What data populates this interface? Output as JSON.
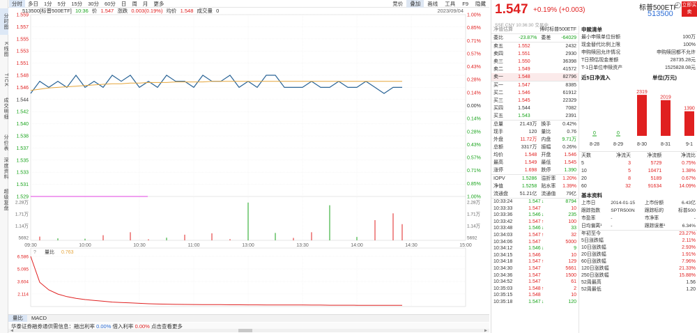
{
  "left_nav": [
    {
      "label": "分时图",
      "active": true
    },
    {
      "label": "K线图",
      "active": false
    },
    {
      "label": "TICK",
      "active": false
    },
    {
      "label": "成交明细",
      "active": false
    },
    {
      "label": "分价表",
      "active": false
    },
    {
      "label": "深度资料",
      "active": false
    },
    {
      "label": "超级复盘",
      "active": false
    }
  ],
  "toolbar": {
    "tabs": [
      "分时",
      "多日",
      "1分",
      "5分",
      "15分",
      "30分",
      "60分",
      "日",
      "周",
      "月",
      "更多"
    ],
    "right": [
      "竞价",
      "叠加",
      "画线",
      "工具",
      "F9",
      "隐藏"
    ]
  },
  "info": {
    "name": "513500[标普500ETF]",
    "time": "10:36",
    "price_label": "价",
    "price": "1.547",
    "chg_label": "涨跌",
    "chg": "0.003(0.19%)",
    "avg_label": "均价",
    "avg": "1.548",
    "vol_label": "成交量",
    "vol": "0",
    "date": "2023/09/04"
  },
  "chart_data": {
    "type": "line",
    "x_ticks": [
      "09:30",
      "10:00",
      "10:30",
      "11:00",
      "13:00",
      "13:30",
      "14:00",
      "14:30",
      "15:00"
    ],
    "price_ticks_left": [
      "1.559",
      "1.557",
      "1.555",
      "1.553",
      "1.551",
      "1.548",
      "1.546",
      "1.544",
      "1.542",
      "1.540",
      "1.538",
      "1.537",
      "1.535",
      "1.533",
      "1.531",
      "1.529"
    ],
    "price_ticks_right": [
      "1.00%",
      "0.85%",
      "0.71%",
      "0.57%",
      "0.43%",
      "0.28%",
      "0.14%",
      "0.00%",
      "0.14%",
      "0.28%",
      "0.43%",
      "0.57%",
      "0.71%",
      "0.85%",
      "1.00%"
    ],
    "ylim": [
      1.529,
      1.559
    ],
    "series": [
      {
        "values": [
          1.546,
          1.548,
          1.547,
          1.548,
          1.547,
          1.549,
          1.547,
          1.548,
          1.547,
          1.549,
          1.548,
          1.549,
          1.547,
          1.548,
          1.547,
          1.549,
          1.548,
          1.548,
          1.547,
          1.549,
          1.548,
          1.548,
          1.549,
          1.547,
          1.548,
          1.547,
          1.549,
          1.549,
          1.547,
          1.547,
          1.547,
          1.548,
          1.547,
          1.547,
          1.548,
          1.547,
          1.547,
          1.548,
          1.547,
          1.546,
          1.547,
          1.547
        ]
      },
      {
        "values": [
          1.5465,
          1.5467,
          1.5469,
          1.547,
          1.5471,
          1.5472,
          1.5473,
          1.5474,
          1.5475,
          1.5476,
          1.5476,
          1.5477,
          1.5477,
          1.5478,
          1.5478,
          1.5478,
          1.5479,
          1.5479,
          1.5479,
          1.5479,
          1.548,
          1.548,
          1.548,
          1.548,
          1.548,
          1.548,
          1.548,
          1.548,
          1.548,
          1.548,
          1.548,
          1.548,
          1.548,
          1.548,
          1.548,
          1.548,
          1.548,
          1.548,
          1.548,
          1.548,
          1.548,
          1.548
        ]
      }
    ],
    "volume_ticks": [
      "2.28万",
      "1.71万",
      "1.14万",
      "5692"
    ],
    "volume_max": 28400,
    "volumes": [
      0,
      2800,
      0,
      1500,
      0,
      0,
      1200,
      0,
      3800,
      0,
      0,
      6000,
      0,
      800,
      0,
      2000,
      0,
      4200,
      0,
      0,
      5200,
      0,
      900,
      0,
      28000,
      0,
      0,
      5500,
      0,
      1800,
      0,
      6000,
      0,
      26000,
      0,
      0,
      2500,
      0,
      15000,
      0,
      20000,
      12000
    ],
    "volratio": {
      "label": "量比",
      "value": "0.763",
      "ticks": [
        "6.586",
        "5.095",
        "3.604",
        "2.114"
      ],
      "ylim": [
        0.62,
        6.586
      ],
      "values": [
        6.586,
        3.5,
        2.6,
        2.1,
        1.8,
        1.6,
        1.45,
        1.35,
        1.25,
        1.15,
        1.1,
        1.05,
        1.0,
        0.95,
        0.92,
        0.9,
        0.88,
        0.87,
        0.86,
        0.85,
        0.84,
        0.84,
        0.83,
        0.83,
        0.82,
        0.82,
        0.81,
        0.81,
        0.8,
        0.8,
        0.8,
        0.79,
        0.79,
        0.78,
        0.78,
        0.78,
        0.77,
        0.77,
        0.77,
        0.77,
        0.76,
        0.763
      ]
    },
    "colors": {
      "price": "#2a6496",
      "avg": "#e5a53a",
      "ref": "#e040e0",
      "vol": "#e02020",
      "volratio": "#e02020"
    }
  },
  "bottom_tabs": [
    "量比",
    "MACD"
  ],
  "status": {
    "text1": "华泰证券融券通供需信息：融出利率",
    "v1": "0.00%",
    "text2": "借入利率",
    "v2": "0.00%",
    "text3": "点击查看更多"
  },
  "quote": {
    "price": "1.547",
    "change": "+0.19% (+0.003)",
    "name": "标普500ETF",
    "code": "513500",
    "buy_btn": "立即买卖",
    "info_icon": "i",
    "subline": "SSE  CNY  10:36:30  交易中",
    "book_head": {
      "left": "净值估算",
      "right": "博时标普500ETF"
    },
    "weibi": {
      "label": "委比",
      "value": "-23.87%",
      "label2": "委差",
      "value2": "-64029"
    },
    "asks": [
      {
        "label": "卖五",
        "price": "1.552",
        "vol": "2432"
      },
      {
        "label": "卖四",
        "price": "1.551",
        "vol": "2930"
      },
      {
        "label": "卖三",
        "price": "1.550",
        "vol": "36398"
      },
      {
        "label": "卖二",
        "price": "1.549",
        "vol": "41572"
      },
      {
        "label": "卖一",
        "price": "1.548",
        "vol": "82796"
      }
    ],
    "bids": [
      {
        "label": "买一",
        "price": "1.547",
        "vol": "8385"
      },
      {
        "label": "买二",
        "price": "1.546",
        "vol": "61912"
      },
      {
        "label": "买三",
        "price": "1.545",
        "vol": "22329"
      },
      {
        "label": "买四",
        "price": "1.544",
        "vol": "7082"
      },
      {
        "label": "买五",
        "price": "1.543",
        "vol": "2391"
      }
    ],
    "stats": [
      {
        "l1": "总量",
        "v1": "21.43万",
        "l2": "换手",
        "v2": "0.42%",
        "c1": "",
        "c2": ""
      },
      {
        "l1": "现手",
        "v1": "120",
        "l2": "量比",
        "v2": "0.76",
        "c1": "",
        "c2": ""
      },
      {
        "l1": "外盘",
        "v1": "11.72万",
        "l2": "内盘",
        "v2": "9.71万",
        "c1": "red",
        "c2": "green"
      },
      {
        "l1": "总额",
        "v1": "3317万",
        "l2": "振幅",
        "v2": "0.26%",
        "c1": "",
        "c2": ""
      },
      {
        "l1": "均价",
        "v1": "1.548",
        "l2": "开盘",
        "v2": "1.546",
        "c1": "red",
        "c2": "red"
      },
      {
        "l1": "最高",
        "v1": "1.549",
        "l2": "最低",
        "v2": "1.545",
        "c1": "red",
        "c2": "red"
      },
      {
        "l1": "涨停",
        "v1": "1.698",
        "l2": "跌停",
        "v2": "1.390",
        "c1": "red",
        "c2": "green"
      }
    ],
    "iopv": [
      {
        "l1": "IOPV",
        "v1": "1.5286",
        "l2": "溢折率",
        "v2": "1.20%",
        "c1": "green",
        "c2": "red"
      },
      {
        "l1": "净值",
        "v1": "1.5258",
        "l2": "贴水率",
        "v2": "1.39%",
        "c1": "green",
        "c2": "red"
      },
      {
        "l1": "流通盘",
        "v1": "51.21亿",
        "l2": "流通值",
        "v2": "79亿",
        "c1": "",
        "c2": ""
      }
    ],
    "trades": [
      {
        "t": "10:33:24",
        "p": "1.547",
        "v": "8794",
        "d": "dn"
      },
      {
        "t": "10:33:33",
        "p": "1.547",
        "v": "10",
        "d": ""
      },
      {
        "t": "10:33:36",
        "p": "1.546",
        "v": "235",
        "d": "dn"
      },
      {
        "t": "10:33:42",
        "p": "1.547",
        "v": "100",
        "d": "up"
      },
      {
        "t": "10:33:48",
        "p": "1.546",
        "v": "33",
        "d": "dn"
      },
      {
        "t": "10:34:03",
        "p": "1.547",
        "v": "32",
        "d": "up"
      },
      {
        "t": "10:34:06",
        "p": "1.547",
        "v": "5000",
        "d": ""
      },
      {
        "t": "10:34:12",
        "p": "1.546",
        "v": "9",
        "d": "dn"
      },
      {
        "t": "10:34:15",
        "p": "1.546",
        "v": "10",
        "d": ""
      },
      {
        "t": "10:34:18",
        "p": "1.547",
        "v": "129",
        "d": "up"
      },
      {
        "t": "10:34:30",
        "p": "1.547",
        "v": "5661",
        "d": ""
      },
      {
        "t": "10:34:36",
        "p": "1.547",
        "v": "1500",
        "d": ""
      },
      {
        "t": "10:34:52",
        "p": "1.547",
        "v": "61",
        "d": ""
      },
      {
        "t": "10:35:03",
        "p": "1.548",
        "v": "2",
        "d": "up"
      },
      {
        "t": "10:35:15",
        "p": "1.548",
        "v": "10",
        "d": ""
      },
      {
        "t": "10:35:18",
        "p": "1.547",
        "v": "120",
        "d": "dn"
      }
    ],
    "shengou": {
      "title": "申赎清单",
      "rows": [
        {
          "l": "最小申赎单位份额",
          "v": "100万"
        },
        {
          "l": "现金替代比例上限",
          "v": "100%"
        },
        {
          "l": "申购赎回允许情况",
          "v": "申购赎回都不允许"
        },
        {
          "l": "T日预估现金差额",
          "v": "28735.28元"
        },
        {
          "l": "T-1日单位申赎资产",
          "v": "1525828.08元"
        }
      ]
    },
    "flow": {
      "title": "近5日净流入",
      "unit": "单位(万元)",
      "days": [
        "8-28",
        "8-29",
        "8-30",
        "8-31",
        "9-1"
      ],
      "values": [
        0,
        0,
        2319,
        2019,
        1390
      ],
      "labels": [
        "0",
        "0",
        "2319",
        "2019",
        "1390"
      ],
      "head": [
        "天数",
        "净流天",
        "净流额",
        "净流比"
      ],
      "rows": [
        {
          "d": "5",
          "n": "3",
          "a": "5729",
          "r": "0.75%"
        },
        {
          "d": "10",
          "n": "5",
          "a": "10471",
          "r": "1.38%"
        },
        {
          "d": "20",
          "n": "8",
          "a": "5189",
          "r": "0.67%"
        },
        {
          "d": "60",
          "n": "32",
          "a": "91634",
          "r": "14.09%"
        }
      ]
    },
    "basic": {
      "title": "基本资料",
      "rows": [
        {
          "l1": "上市日",
          "v1": "2014-01-15",
          "l2": "上市份额",
          "v2": "6.43亿"
        },
        {
          "l1": "跟踪指数",
          "v1": "SPTR500N",
          "l2": "跟踪标的",
          "v2": "标普500"
        },
        {
          "l1": "市盈率",
          "v1": "-",
          "l2": "市净率",
          "v2": "-"
        },
        {
          "l1": "日均偏离¹",
          "v1": "-",
          "l2": "跟踪误差¹",
          "v2": "6.34%"
        }
      ]
    },
    "perf": [
      {
        "l": "年初至今",
        "v": "23.27%"
      },
      {
        "l": "5日涨跌幅",
        "v": "2.11%"
      },
      {
        "l": "10日涨跌幅",
        "v": "2.93%"
      },
      {
        "l": "20日涨跌幅",
        "v": "1.91%"
      },
      {
        "l": "60日涨跌幅",
        "v": "7.96%"
      },
      {
        "l": "120日涨跌幅",
        "v": "21.33%"
      },
      {
        "l": "250日涨跌幅",
        "v": "15.88%"
      },
      {
        "l": "52周最高",
        "v": "1.56"
      },
      {
        "l": "52周最低",
        "v": "1.20"
      }
    ]
  }
}
